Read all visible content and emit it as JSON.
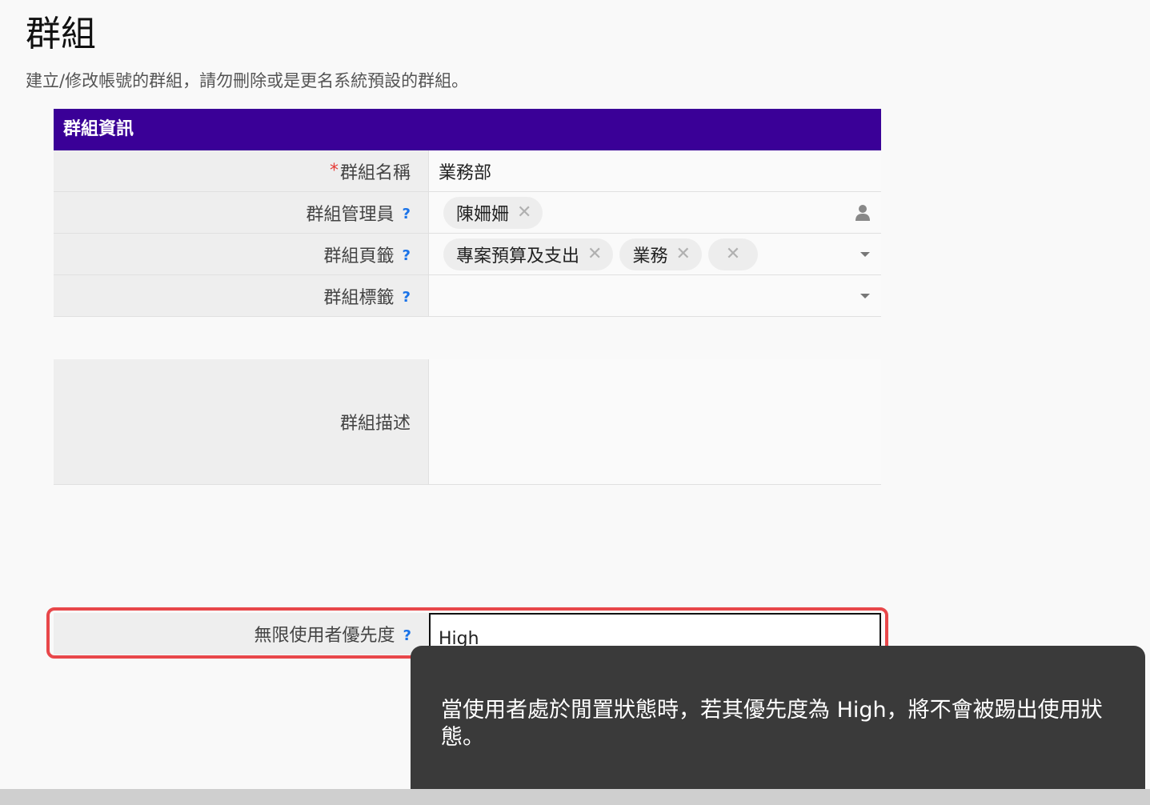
{
  "page": {
    "title": "群組",
    "description": "建立/修改帳號的群組，請勿刪除或是更名系統預設的群組。"
  },
  "panel": {
    "header": "群組資訊",
    "rows": {
      "name": {
        "required_mark": "*",
        "label": "群組名稱",
        "value": "業務部"
      },
      "admin": {
        "label": "群組管理員",
        "help": "?",
        "chips": [
          "陳姍姍"
        ],
        "icon": "user-icon"
      },
      "pages": {
        "label": "群組頁籤",
        "help": "?",
        "chips": [
          "專案預算及支出",
          "業務",
          ""
        ],
        "icon": "caret-down-icon"
      },
      "tags": {
        "label": "群組標籤",
        "help": "?",
        "icon": "caret-down-icon"
      },
      "description": {
        "label": "群組描述",
        "value": ""
      }
    }
  },
  "priority": {
    "label": "無限使用者優先度",
    "help": "?",
    "value": "High"
  },
  "tooltip": {
    "text": "當使用者處於閒置狀態時，若其優先度為 High，將不會被踢出使用狀態。"
  },
  "colors": {
    "header_bg": "#3a0097",
    "highlight_border": "#e8474a",
    "tooltip_bg": "#3a3a3a",
    "help_icon": "#1a73e8"
  }
}
